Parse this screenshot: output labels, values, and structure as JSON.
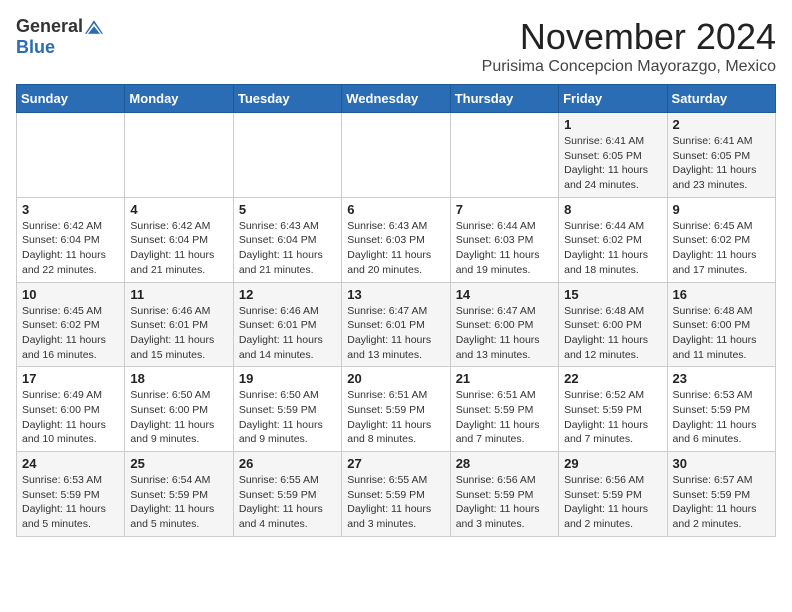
{
  "header": {
    "logo_general": "General",
    "logo_blue": "Blue",
    "month_title": "November 2024",
    "location": "Purisima Concepcion Mayorazgo, Mexico"
  },
  "weekdays": [
    "Sunday",
    "Monday",
    "Tuesday",
    "Wednesday",
    "Thursday",
    "Friday",
    "Saturday"
  ],
  "weeks": [
    [
      {
        "day": "",
        "info": ""
      },
      {
        "day": "",
        "info": ""
      },
      {
        "day": "",
        "info": ""
      },
      {
        "day": "",
        "info": ""
      },
      {
        "day": "",
        "info": ""
      },
      {
        "day": "1",
        "info": "Sunrise: 6:41 AM\nSunset: 6:05 PM\nDaylight: 11 hours and 24 minutes."
      },
      {
        "day": "2",
        "info": "Sunrise: 6:41 AM\nSunset: 6:05 PM\nDaylight: 11 hours and 23 minutes."
      }
    ],
    [
      {
        "day": "3",
        "info": "Sunrise: 6:42 AM\nSunset: 6:04 PM\nDaylight: 11 hours and 22 minutes."
      },
      {
        "day": "4",
        "info": "Sunrise: 6:42 AM\nSunset: 6:04 PM\nDaylight: 11 hours and 21 minutes."
      },
      {
        "day": "5",
        "info": "Sunrise: 6:43 AM\nSunset: 6:04 PM\nDaylight: 11 hours and 21 minutes."
      },
      {
        "day": "6",
        "info": "Sunrise: 6:43 AM\nSunset: 6:03 PM\nDaylight: 11 hours and 20 minutes."
      },
      {
        "day": "7",
        "info": "Sunrise: 6:44 AM\nSunset: 6:03 PM\nDaylight: 11 hours and 19 minutes."
      },
      {
        "day": "8",
        "info": "Sunrise: 6:44 AM\nSunset: 6:02 PM\nDaylight: 11 hours and 18 minutes."
      },
      {
        "day": "9",
        "info": "Sunrise: 6:45 AM\nSunset: 6:02 PM\nDaylight: 11 hours and 17 minutes."
      }
    ],
    [
      {
        "day": "10",
        "info": "Sunrise: 6:45 AM\nSunset: 6:02 PM\nDaylight: 11 hours and 16 minutes."
      },
      {
        "day": "11",
        "info": "Sunrise: 6:46 AM\nSunset: 6:01 PM\nDaylight: 11 hours and 15 minutes."
      },
      {
        "day": "12",
        "info": "Sunrise: 6:46 AM\nSunset: 6:01 PM\nDaylight: 11 hours and 14 minutes."
      },
      {
        "day": "13",
        "info": "Sunrise: 6:47 AM\nSunset: 6:01 PM\nDaylight: 11 hours and 13 minutes."
      },
      {
        "day": "14",
        "info": "Sunrise: 6:47 AM\nSunset: 6:00 PM\nDaylight: 11 hours and 13 minutes."
      },
      {
        "day": "15",
        "info": "Sunrise: 6:48 AM\nSunset: 6:00 PM\nDaylight: 11 hours and 12 minutes."
      },
      {
        "day": "16",
        "info": "Sunrise: 6:48 AM\nSunset: 6:00 PM\nDaylight: 11 hours and 11 minutes."
      }
    ],
    [
      {
        "day": "17",
        "info": "Sunrise: 6:49 AM\nSunset: 6:00 PM\nDaylight: 11 hours and 10 minutes."
      },
      {
        "day": "18",
        "info": "Sunrise: 6:50 AM\nSunset: 6:00 PM\nDaylight: 11 hours and 9 minutes."
      },
      {
        "day": "19",
        "info": "Sunrise: 6:50 AM\nSunset: 5:59 PM\nDaylight: 11 hours and 9 minutes."
      },
      {
        "day": "20",
        "info": "Sunrise: 6:51 AM\nSunset: 5:59 PM\nDaylight: 11 hours and 8 minutes."
      },
      {
        "day": "21",
        "info": "Sunrise: 6:51 AM\nSunset: 5:59 PM\nDaylight: 11 hours and 7 minutes."
      },
      {
        "day": "22",
        "info": "Sunrise: 6:52 AM\nSunset: 5:59 PM\nDaylight: 11 hours and 7 minutes."
      },
      {
        "day": "23",
        "info": "Sunrise: 6:53 AM\nSunset: 5:59 PM\nDaylight: 11 hours and 6 minutes."
      }
    ],
    [
      {
        "day": "24",
        "info": "Sunrise: 6:53 AM\nSunset: 5:59 PM\nDaylight: 11 hours and 5 minutes."
      },
      {
        "day": "25",
        "info": "Sunrise: 6:54 AM\nSunset: 5:59 PM\nDaylight: 11 hours and 5 minutes."
      },
      {
        "day": "26",
        "info": "Sunrise: 6:55 AM\nSunset: 5:59 PM\nDaylight: 11 hours and 4 minutes."
      },
      {
        "day": "27",
        "info": "Sunrise: 6:55 AM\nSunset: 5:59 PM\nDaylight: 11 hours and 3 minutes."
      },
      {
        "day": "28",
        "info": "Sunrise: 6:56 AM\nSunset: 5:59 PM\nDaylight: 11 hours and 3 minutes."
      },
      {
        "day": "29",
        "info": "Sunrise: 6:56 AM\nSunset: 5:59 PM\nDaylight: 11 hours and 2 minutes."
      },
      {
        "day": "30",
        "info": "Sunrise: 6:57 AM\nSunset: 5:59 PM\nDaylight: 11 hours and 2 minutes."
      }
    ]
  ]
}
